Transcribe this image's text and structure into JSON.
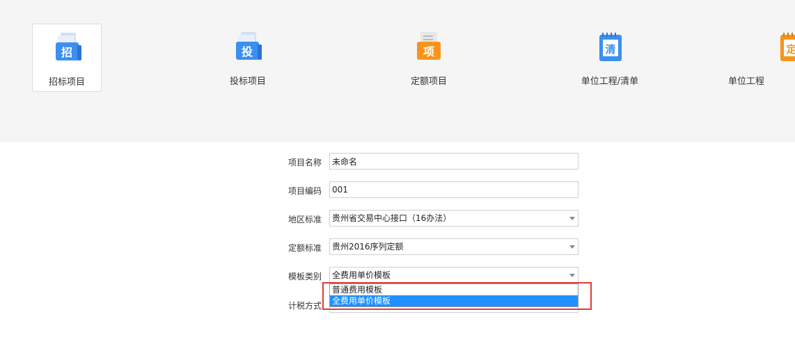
{
  "project_types": [
    {
      "label": "招标项目",
      "glyph": "招",
      "color": "#3b8ff0",
      "icon": "bid-invitation-icon",
      "selected": true
    },
    {
      "label": "投标项目",
      "glyph": "投",
      "color": "#3b8ff0",
      "icon": "bid-submission-icon",
      "selected": false
    },
    {
      "label": "定额项目",
      "glyph": "项",
      "color": "#f7941d",
      "icon": "quota-project-icon",
      "selected": false
    },
    {
      "label": "单位工程/清单",
      "glyph": "清",
      "color": "#3b8ff0",
      "icon": "bill-list-icon",
      "selected": false
    },
    {
      "label": "单位工程",
      "glyph": "定",
      "color": "#f7941d",
      "icon": "unit-quota-icon",
      "selected": false
    }
  ],
  "form": {
    "project_name": {
      "label": "项目名称",
      "value": "未命名"
    },
    "project_code": {
      "label": "项目编码",
      "value": "001"
    },
    "region_standard": {
      "label": "地区标准",
      "value": "贵州省交易中心接口（16办法）"
    },
    "quota_standard": {
      "label": "定额标准",
      "value": "贵州2016序列定额"
    },
    "template_type": {
      "label": "模板类别",
      "value": "全费用单价模板",
      "options": [
        "普通费用模板",
        "全费用单价模板"
      ],
      "highlighted_option": 1
    },
    "tax_method": {
      "label": "计税方式"
    }
  },
  "colors": {
    "selection": "#1e90ff",
    "annotation_border": "#e53935",
    "panel_bg": "#f5f5f5"
  }
}
